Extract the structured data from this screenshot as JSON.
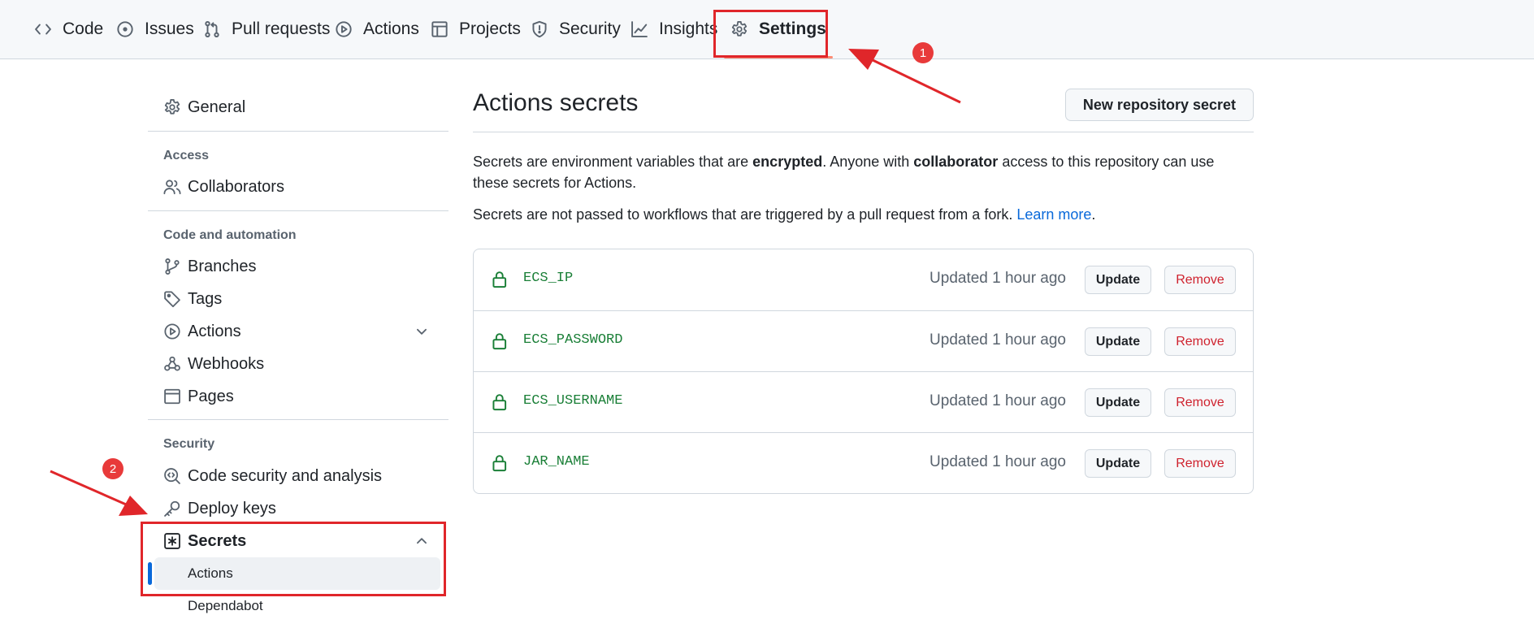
{
  "topnav": {
    "tabs": [
      {
        "label": "Code",
        "icon": "code-icon"
      },
      {
        "label": "Issues",
        "icon": "issue-icon"
      },
      {
        "label": "Pull requests",
        "icon": "pull-request-icon"
      },
      {
        "label": "Actions",
        "icon": "play-icon"
      },
      {
        "label": "Projects",
        "icon": "table-icon"
      },
      {
        "label": "Security",
        "icon": "shield-icon"
      },
      {
        "label": "Insights",
        "icon": "graph-icon"
      },
      {
        "label": "Settings",
        "icon": "gear-icon",
        "selected": true
      }
    ]
  },
  "sidebar": {
    "general": "General",
    "access_heading": "Access",
    "collaborators": "Collaborators",
    "code_heading": "Code and automation",
    "branches": "Branches",
    "tags": "Tags",
    "actions": "Actions",
    "webhooks": "Webhooks",
    "pages": "Pages",
    "security_heading": "Security",
    "code_security": "Code security and analysis",
    "deploy_keys": "Deploy keys",
    "secrets": "Secrets",
    "secrets_sub": [
      {
        "label": "Actions",
        "active": true
      },
      {
        "label": "Dependabot",
        "active": false
      }
    ]
  },
  "main": {
    "title": "Actions secrets",
    "new_button": "New repository secret",
    "desc1_pre": "Secrets are environment variables that are ",
    "desc1_b1": "encrypted",
    "desc1_mid": ". Anyone with ",
    "desc1_b2": "collaborator",
    "desc1_post": " access to this repository can use these secrets for Actions.",
    "desc2_pre": "Secrets are not passed to workflows that are triggered by a pull request from a fork. ",
    "desc2_link": "Learn more",
    "desc2_post": ".",
    "secrets": [
      {
        "name": "ECS_IP",
        "updated": "Updated 1 hour ago"
      },
      {
        "name": "ECS_PASSWORD",
        "updated": "Updated 1 hour ago"
      },
      {
        "name": "ECS_USERNAME",
        "updated": "Updated 1 hour ago"
      },
      {
        "name": "JAR_NAME",
        "updated": "Updated 1 hour ago"
      }
    ],
    "update_label": "Update",
    "remove_label": "Remove"
  },
  "annotations": {
    "badge1": "1",
    "badge2": "2",
    "color": "#e0262a"
  }
}
